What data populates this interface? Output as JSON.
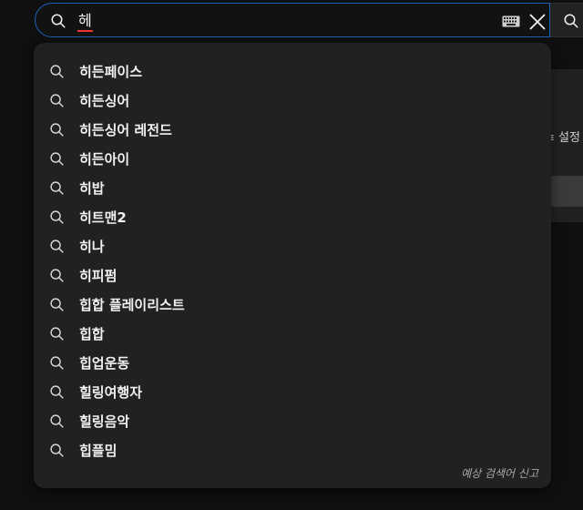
{
  "search": {
    "query": "헤",
    "placeholder": "",
    "keyboard_icon": "keyboard-icon",
    "clear_icon": "close-icon",
    "search_icon": "search-icon"
  },
  "background": {
    "partial_text": "≡ 설정"
  },
  "suggestions": [
    {
      "label": "히든페이스"
    },
    {
      "label": "히든싱어"
    },
    {
      "label": "히든싱어 레전드"
    },
    {
      "label": "히든아이"
    },
    {
      "label": "히밥"
    },
    {
      "label": "히트맨2"
    },
    {
      "label": "히나"
    },
    {
      "label": "히피펌"
    },
    {
      "label": "힙합 플레이리스트"
    },
    {
      "label": "힙합"
    },
    {
      "label": "힙업운동"
    },
    {
      "label": "힐링여행자"
    },
    {
      "label": "힐링음악"
    },
    {
      "label": "힙플밈"
    }
  ],
  "report_link": "예상 검색어 신고",
  "colors": {
    "background": "#0f0f0f",
    "dropdown": "#212121",
    "accent_border": "#1c62b9",
    "text": "#f1f1f1",
    "muted": "#aaaaaa"
  }
}
